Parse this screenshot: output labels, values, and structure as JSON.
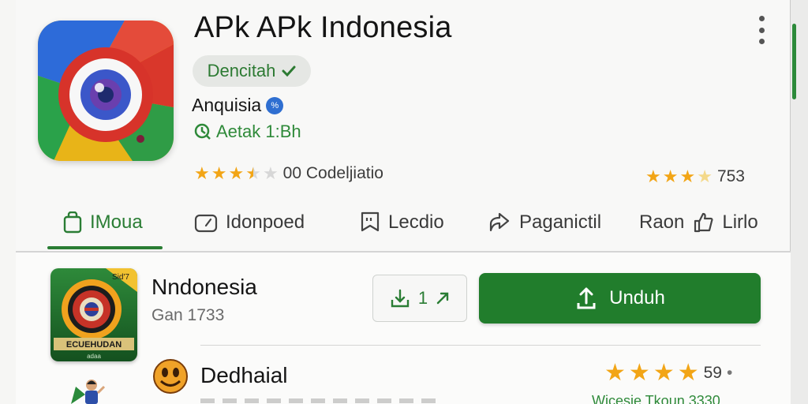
{
  "app": {
    "title": "APk APk Indonesia",
    "verified_label": "Dencitah",
    "developer": "Anquisia",
    "developer_badge": "%",
    "update_text": "Aetak 1:Bh",
    "rating_label": "00 Codeljiatio",
    "rating_stars": 3.5,
    "rating_right_value": "753",
    "rating_right_stars": 4
  },
  "tabs": [
    {
      "label": "IMoua",
      "icon": "bag-icon",
      "active": true
    },
    {
      "label": "Idonpoed",
      "icon": "gauge-icon",
      "active": false
    },
    {
      "label": "Lecdio",
      "icon": "bookmark-quote-icon",
      "active": false
    },
    {
      "label": "Paganictil",
      "icon": "share-icon",
      "active": false
    },
    {
      "label": "Raon",
      "icon": "",
      "active": false
    },
    {
      "label": "Lirlo",
      "icon": "thumb-icon",
      "active": false
    }
  ],
  "list": {
    "item1": {
      "title": "Nndonesia",
      "subtitle": "Gan 1733",
      "icon_label": "ECUEHUDAN",
      "icon_tag": "Sid'7",
      "icon_small": "adaa",
      "secondary_button": "1",
      "primary_button": "Unduh"
    },
    "item2": {
      "title": "Dedhaial",
      "rating_value": "59",
      "rating_stars": 4,
      "subtitle": "Wicesie Tkoun 3330"
    }
  },
  "colors": {
    "accent_green": "#217d2c",
    "text_green": "#2f8a3a",
    "star": "#f2a516"
  }
}
